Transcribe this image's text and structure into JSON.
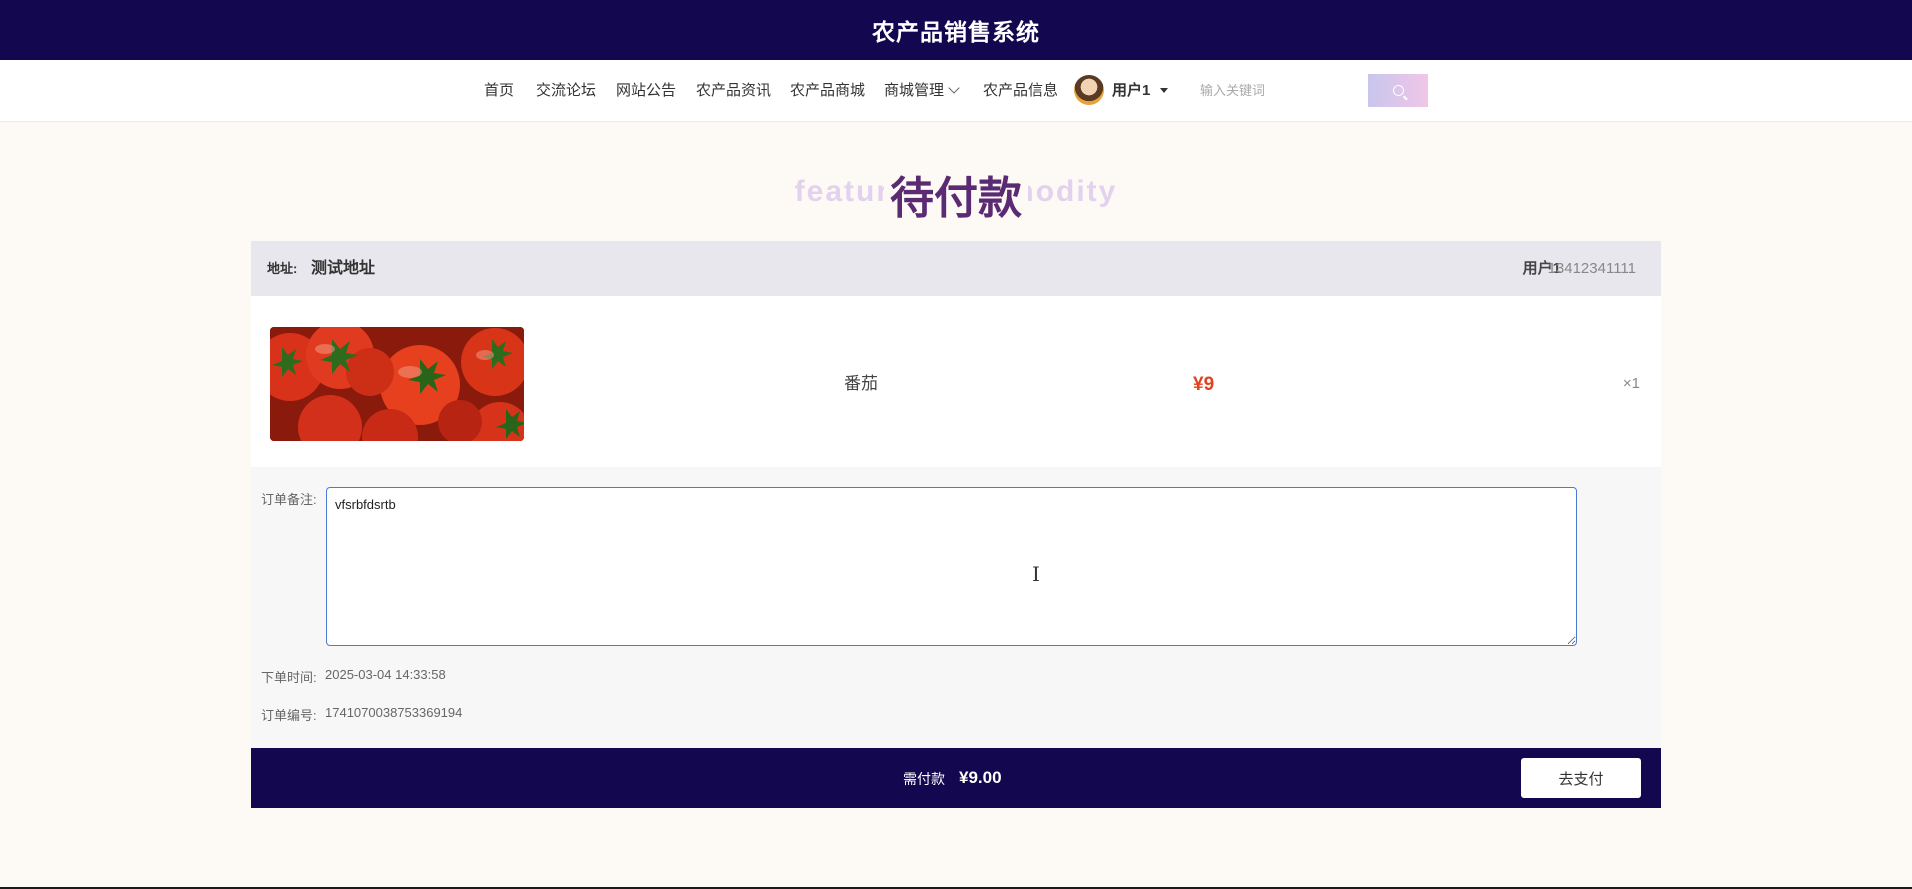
{
  "header": {
    "title": "农产品销售系统"
  },
  "nav": {
    "items": [
      {
        "label": "首页"
      },
      {
        "label": "交流论坛"
      },
      {
        "label": "网站公告"
      },
      {
        "label": "农产品资讯"
      },
      {
        "label": "农产品商城"
      },
      {
        "label": "商城管理",
        "has_dropdown": true
      },
      {
        "label": "农产品信息"
      }
    ],
    "user": {
      "name": "用户1"
    },
    "search": {
      "placeholder": "输入关键词",
      "button_icon": "search-icon"
    }
  },
  "page": {
    "bg_text": "featured commodity",
    "title": "待付款"
  },
  "address": {
    "label": "地址:",
    "value": "测试地址",
    "user": "用户1",
    "phone": "13412341111"
  },
  "product": {
    "image": "tomatoes",
    "name": "番茄",
    "price": "¥9",
    "qty": "×1"
  },
  "order": {
    "note_label": "订单备注:",
    "note_value": "vfsrbfdsrtb",
    "time_label": "下单时间:",
    "time_value": "2025-03-04 14:33:58",
    "no_label": "订单编号:",
    "no_value": "1741070038753369194"
  },
  "payment": {
    "label": "需付款",
    "amount": "¥9.00",
    "button": "去支付"
  },
  "colors": {
    "header_bg": "#13074f",
    "title_color": "#5a2a72",
    "price_color": "#e0431f",
    "input_border": "#4a7bd0"
  }
}
